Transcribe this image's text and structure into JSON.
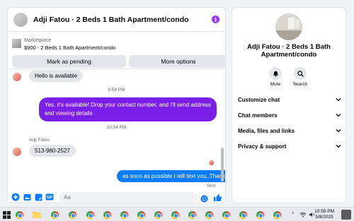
{
  "chat": {
    "title": "Adji Fatou · 2 Beds 1 Bath Apartment/condo",
    "listing": {
      "category": "Marketplace",
      "description": "$900 - 2 Beds 1 Bath Apartment/condo",
      "pending_label": "Mark as pending",
      "options_label": "More options"
    },
    "messages": {
      "msg1": "Hello is available",
      "time1": "6:58 PM",
      "msg2": "Yes, it's available! Drop your contact number, and I'll send address and viewing details",
      "time2": "10:54 PM",
      "sender": "Adji Fatou",
      "msg3": "513-960-2527",
      "msg4": "as soon as possible I will text you..Thanks",
      "sent": "Sent"
    },
    "composer": {
      "placeholder": "Aa"
    }
  },
  "info": {
    "name": "Adji Fatou · 2 Beds 1 Bath Apartment/condo",
    "mute_label": "Mute",
    "search_label": "Search",
    "sections": [
      "Customize chat",
      "Chat members",
      "Media, files and links",
      "Privacy & support"
    ]
  },
  "taskbar": {
    "time": "10:55 PM",
    "date": "5/8/2025",
    "tray": "^",
    "icons": [
      "windows-icon",
      "chrome-icon",
      "file-explorer-icon",
      "chrome-icon",
      "chrome-icon",
      "chrome-icon",
      "chrome-icon",
      "chrome-icon",
      "chrome-icon",
      "chrome-icon",
      "chrome-icon",
      "chrome-icon",
      "chrome-icon",
      "chrome-icon",
      "chrome-icon",
      "chrome-icon",
      "chrome-icon"
    ]
  },
  "colors": {
    "accent": "#7b1fe8",
    "blue": "#0a7cff",
    "panel": "#ffffff",
    "bg": "#f0f2f5"
  }
}
